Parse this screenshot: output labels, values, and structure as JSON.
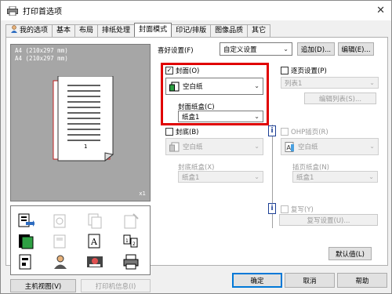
{
  "window": {
    "title": "打印首选项",
    "close_glyph": "✕"
  },
  "tabs": [
    {
      "label": "我的选项",
      "icon": "user-icon"
    },
    {
      "label": "基本"
    },
    {
      "label": "布局"
    },
    {
      "label": "排纸处理"
    },
    {
      "label": "封面模式",
      "active": true
    },
    {
      "label": "印记/排版"
    },
    {
      "label": "图像品质"
    },
    {
      "label": "其它"
    }
  ],
  "preview": {
    "size_line1": "A4 (210x297 mm)",
    "size_line2": "A4 (210x297 mm)",
    "copies": "x1",
    "page_number": "1"
  },
  "left_buttons": {
    "printer_view": "主机视图(V)",
    "printer_info": "打印机信息(I)"
  },
  "favorites": {
    "label": "喜好设置(F)",
    "value": "自定义设置",
    "add_button": "追加(D)...",
    "edit_button": "编辑(E)..."
  },
  "front_cover": {
    "checkbox_label": "封面(O)",
    "checked": true,
    "paper_value": "空白纸",
    "tray_label": "封面纸盒(C)",
    "tray_value": "纸盒1"
  },
  "back_cover": {
    "checkbox_label": "封底(B)",
    "checked": false,
    "paper_value": "空白纸",
    "tray_label": "封底纸盒(X)",
    "tray_value": "纸盒1"
  },
  "per_page": {
    "checkbox_label": "逐页设置(P)",
    "list_value": "列表1",
    "edit_list_button": "编辑列表(S)..."
  },
  "ohp": {
    "checkbox_label": "OHP插页(R)",
    "paper_value": "空白纸",
    "tray_label": "插页纸盒(N)",
    "tray_value": "纸盒1"
  },
  "carbon": {
    "checkbox_label": "复写(Y)",
    "settings_button": "复写设置(U)..."
  },
  "defaults_button": "默认值(L)",
  "bottom_buttons": {
    "ok": "确定",
    "cancel": "取消",
    "help": "帮助"
  },
  "info_icon_glyph": "i",
  "colors": {
    "highlight": "#e00000",
    "accent": "#0078d7"
  }
}
